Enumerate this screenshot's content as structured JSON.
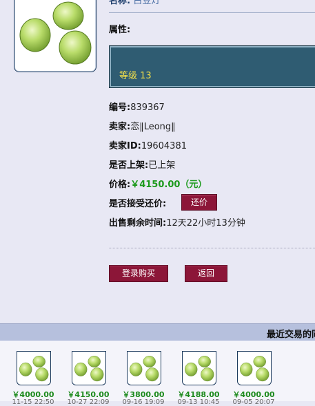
{
  "item": {
    "name_label": "名称:",
    "name_value": "白豆灯",
    "attr_label": "属性:",
    "attr_level": "等级 13"
  },
  "details": {
    "id_label": "编号:",
    "id_value": "839367",
    "seller_label": "卖家:",
    "seller_value": "恋‖Leong‖",
    "seller_id_label": "卖家ID:",
    "seller_id_value": "19604381",
    "listed_label": "是否上架:",
    "listed_value": "已上架",
    "price_label": "价格:",
    "price_value": "￥4150.00（元）",
    "bargain_label": "是否接受还价:",
    "bargain_button": "还价",
    "remaining_label": "出售剩余时间:",
    "remaining_value": "12天22小时13分钟"
  },
  "actions": {
    "buy_label": "登录购买",
    "back_label": "返回"
  },
  "recent": {
    "title": "最近交易的同",
    "items": [
      {
        "price": "￥4000.00",
        "date": "11-15 22:50"
      },
      {
        "price": "￥4150.00",
        "date": "10-27 22:09"
      },
      {
        "price": "￥3800.00",
        "date": "09-16 19:09"
      },
      {
        "price": "￥4188.00",
        "date": "09-13 10:45"
      },
      {
        "price": "￥4000.00",
        "date": "09-05 20:07"
      }
    ]
  },
  "icons": {
    "item_image": "green-bean-cluster-icon"
  },
  "colors": {
    "button_bg": "#8c1638",
    "price_green": "#1c9a1c",
    "attr_box_bg": "#2f5c72",
    "attr_text": "#f3e04a",
    "header_bar": "#b6c0dd"
  }
}
